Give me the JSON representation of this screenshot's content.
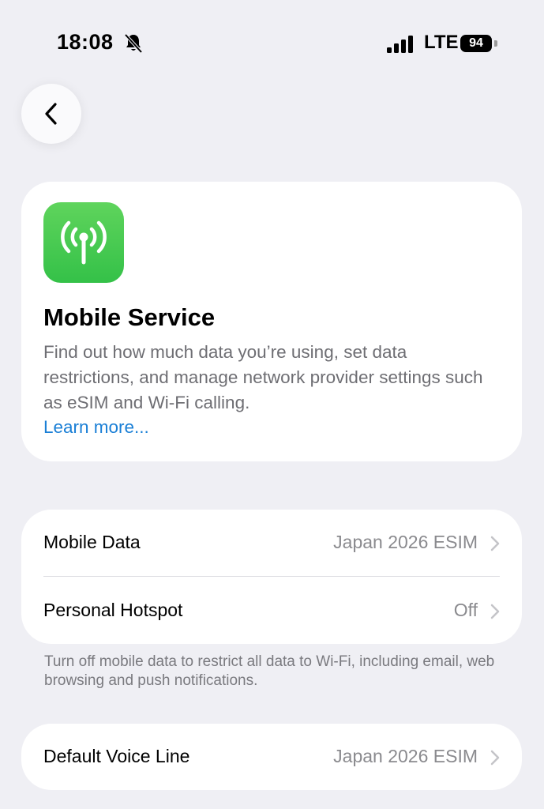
{
  "status_bar": {
    "time": "18:08",
    "network": "LTE",
    "battery": "94"
  },
  "info_card": {
    "title": "Mobile Service",
    "description": "Find out how much data you’re using, set data restrictions, and manage network provider settings such as eSIM and Wi-Fi calling.",
    "learn_more": "Learn more...",
    "icon_color": "#34c759"
  },
  "settings": {
    "rows": [
      {
        "label": "Mobile Data",
        "value": "Japan 2026 ESIM"
      },
      {
        "label": "Personal Hotspot",
        "value": "Off"
      }
    ],
    "footnote": "Turn off mobile data to restrict all data to Wi-Fi, including email, web browsing and push notifications."
  },
  "voice": {
    "label": "Default Voice Line",
    "value": "Japan 2026 ESIM"
  },
  "colors": {
    "background": "#efeff4",
    "link": "#1a7fd6",
    "secondary_text": "#8a8a8e"
  }
}
